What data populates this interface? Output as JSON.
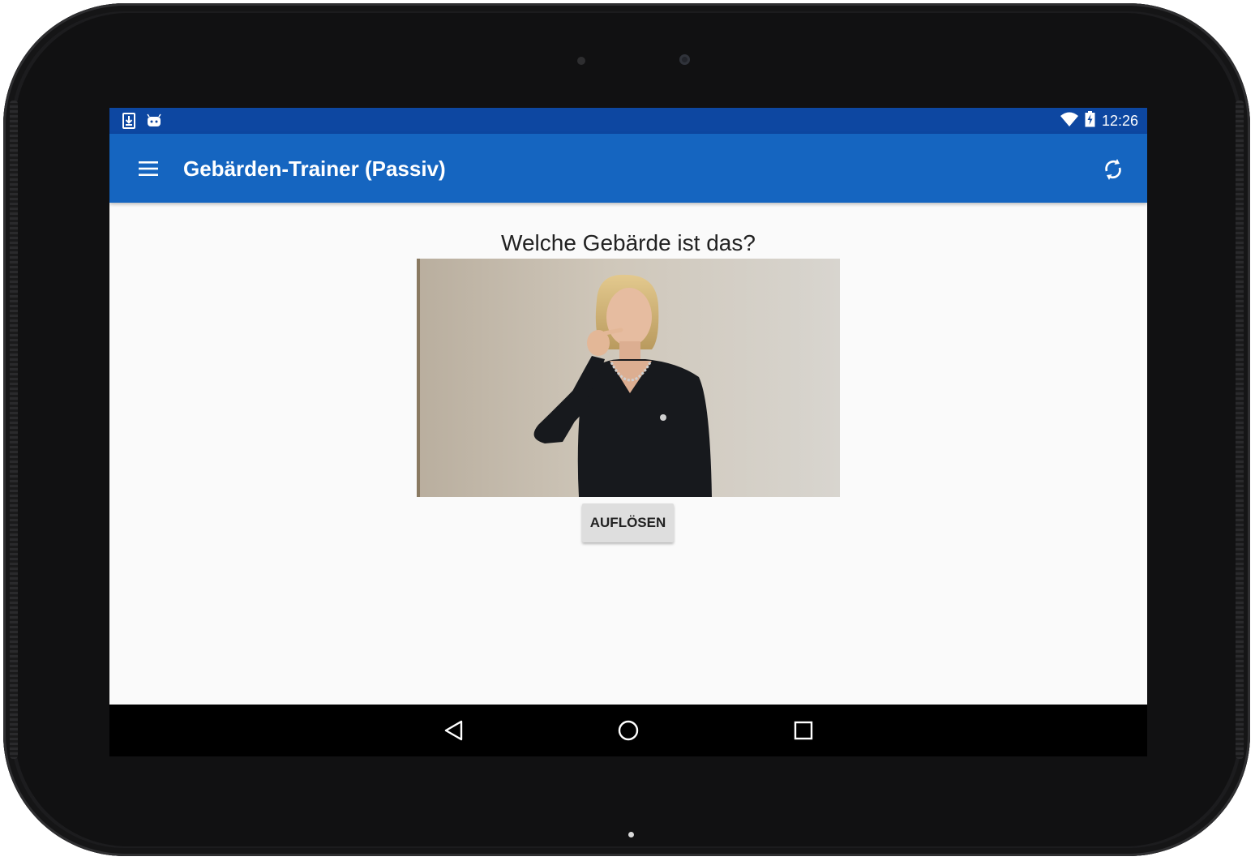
{
  "status_bar": {
    "notification_icons": [
      "download-icon",
      "android-debug-icon"
    ],
    "system_icons": [
      "wifi-icon",
      "battery-charging-icon"
    ],
    "time": "12:26"
  },
  "app_bar": {
    "title": "Gebärden-Trainer (Passiv)",
    "left_icon": "menu-icon",
    "right_icon": "refresh-icon"
  },
  "main": {
    "question": "Welche Gebärde ist das?",
    "video": {
      "description_icon": "sign-language-video"
    },
    "reveal_button": "AUFLÖSEN"
  },
  "nav_bar": {
    "buttons": [
      "back-icon",
      "home-icon",
      "recents-icon"
    ]
  },
  "colors": {
    "status_bar": "#0d47a1",
    "app_bar": "#1565c0",
    "background": "#fafafa",
    "button": "#dedede"
  }
}
